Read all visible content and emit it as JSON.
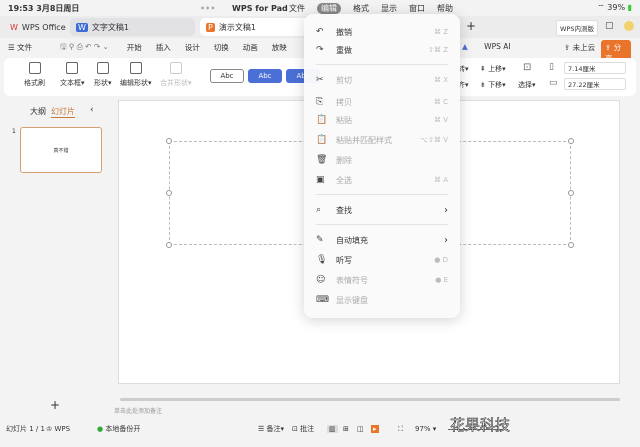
{
  "status_bar": {
    "time": "19:53",
    "date": "3月8日周日",
    "app": "WPS for Pad",
    "battery": "39%"
  },
  "app_menu": [
    "文件",
    "编辑",
    "格式",
    "显示",
    "窗口",
    "帮助"
  ],
  "tabs": [
    {
      "label": "WPS Office"
    },
    {
      "label": "文字文稿1"
    },
    {
      "label": "演示文稿1"
    }
  ],
  "top_right": {
    "internal": "WPS内测版",
    "cloud": "未上云",
    "share": "分享",
    "ai": "WPS AI"
  },
  "ribbon_tabs": [
    "文件",
    "开始",
    "插入",
    "设计",
    "切换",
    "动画",
    "放映"
  ],
  "ribbon": {
    "format_painter": "格式刷",
    "textbox": "文本框",
    "shape": "形状",
    "edit_shape": "编辑形状",
    "merge_shape": "合并形状",
    "style_samples": [
      "Abc",
      "Abc",
      "Abc"
    ],
    "rotate": "转",
    "align": "齐",
    "move_up": "上移",
    "move_down": "下移",
    "select": "选择",
    "width": "7.14厘米",
    "height": "27.22厘米"
  },
  "edit_menu": {
    "items": [
      {
        "label": "撤销",
        "icon": "undo-icon",
        "glyph": "↶",
        "shortcut": "⌘ Z",
        "enabled": true
      },
      {
        "label": "重做",
        "icon": "redo-icon",
        "glyph": "↷",
        "shortcut": "⇧⌘ Z",
        "enabled": true
      },
      {
        "label": "剪切",
        "icon": "scissors-icon",
        "glyph": "✂",
        "shortcut": "⌘ X",
        "enabled": false
      },
      {
        "label": "拷贝",
        "icon": "copy-icon",
        "glyph": "⎘",
        "shortcut": "⌘ C",
        "enabled": false
      },
      {
        "label": "粘贴",
        "icon": "paste-icon",
        "glyph": "📋",
        "shortcut": "⌘ V",
        "enabled": false
      },
      {
        "label": "粘贴并匹配样式",
        "icon": "paste-match-icon",
        "glyph": "📋",
        "shortcut": "⌥⇧⌘ V",
        "enabled": false
      },
      {
        "label": "删除",
        "icon": "trash-icon",
        "glyph": "🗑",
        "shortcut": "",
        "enabled": false
      },
      {
        "label": "全选",
        "icon": "select-all-icon",
        "glyph": "▣",
        "shortcut": "⌘ A",
        "enabled": false
      },
      {
        "label": "查找",
        "icon": "find-icon",
        "glyph": "⌕",
        "shortcut": "›",
        "enabled": true
      },
      {
        "label": "自动填充",
        "icon": "autofill-icon",
        "glyph": "✎",
        "shortcut": "›",
        "enabled": true
      },
      {
        "label": "听写",
        "icon": "microphone-icon",
        "glyph": "🎙",
        "shortcut": "● D",
        "enabled": true
      },
      {
        "label": "表情符号",
        "icon": "emoji-icon",
        "glyph": "☺",
        "shortcut": "● E",
        "enabled": false
      },
      {
        "label": "显示键盘",
        "icon": "keyboard-icon",
        "glyph": "⌨",
        "shortcut": "",
        "enabled": false
      }
    ]
  },
  "sidebar": {
    "outline_tab": "大纲",
    "slides_tab": "幻灯片",
    "slide_number": "1",
    "thumb_text": "真不错",
    "add": "+"
  },
  "notes_placeholder": "单击此处添加备注",
  "bottom": {
    "slide_count": "幻灯片 1 / 1",
    "wps": "WPS",
    "backup": "本地备份开",
    "notes": "备注",
    "comment": "批注",
    "zoom": "97%"
  },
  "watermark": "花果科技",
  "colors": {
    "accent": "#e8752b",
    "blue": "#4a6fd6"
  }
}
